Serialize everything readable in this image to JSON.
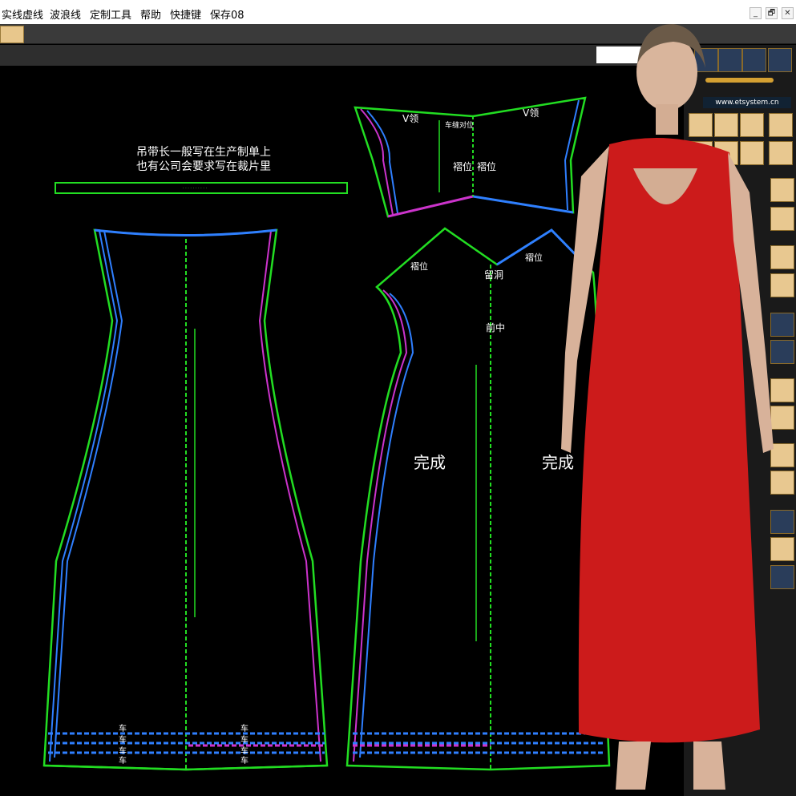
{
  "menu": [
    "实线虚线",
    "波浪线",
    "定制工具",
    "帮助",
    "快捷键",
    "保存08"
  ],
  "window_controls": [
    "_",
    "🗗",
    "✕"
  ],
  "site_url": "www.etsystem.cn",
  "annotations": {
    "note_line1": "吊带长一般写在生产制单上",
    "note_line2": "也有公司会要求写在裁片里",
    "v_neck_left": "V领",
    "v_neck_right": "V领",
    "top_center_label": "车缝对位",
    "pleat_pos_a": "褶位",
    "pleat_pos_b": "褶位",
    "pleat_pos_c": "褶位",
    "pleat_pos_d": "褶位",
    "leave_hole": "留洞",
    "front_center": "前中",
    "done_left": "完成",
    "done_right": "完成",
    "sew_1": "车",
    "sew_2": "车",
    "sew_3": "车",
    "sew_4": "车",
    "sew_5": "车",
    "sew_6": "车",
    "sew_7": "车",
    "sew_8": "车"
  },
  "colors": {
    "background": "#000000",
    "outline_green": "#22dd22",
    "seam_blue": "#2f7fff",
    "seam_magenta": "#cc33cc",
    "dress_red": "#cc1b1b"
  },
  "icons": [
    "pencil-icon",
    "ruler-icon",
    "scissors-icon",
    "calculator-icon",
    "abc-icon"
  ]
}
